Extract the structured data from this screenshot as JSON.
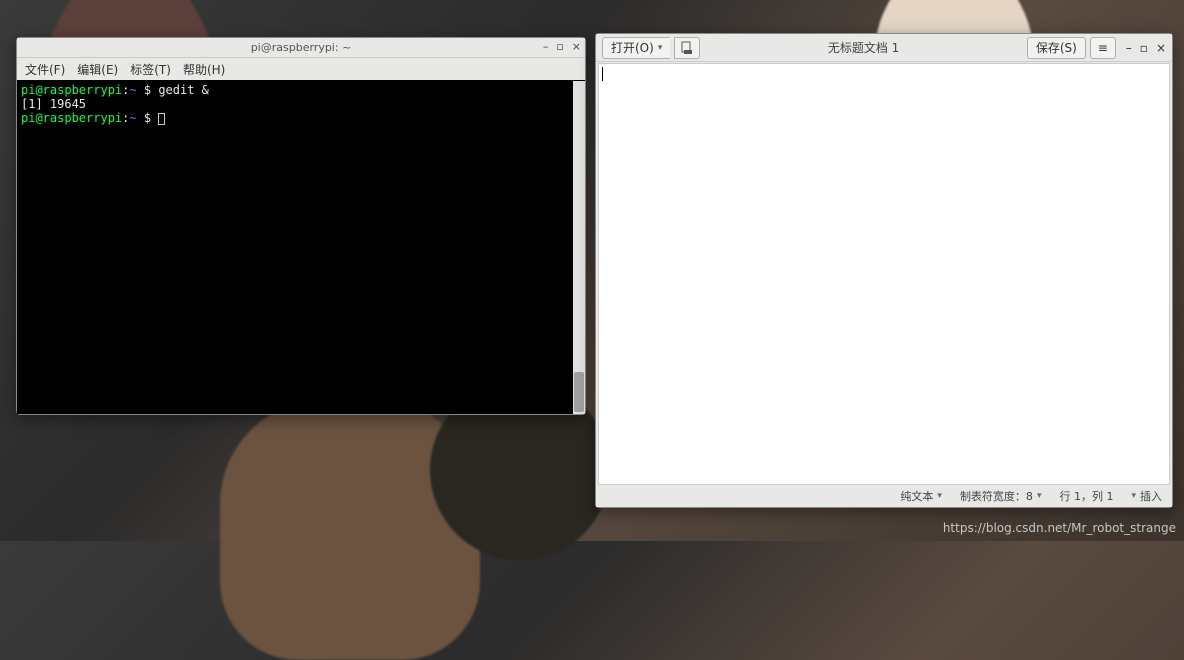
{
  "terminal": {
    "title": "pi@raspberrypi: ~",
    "menu": {
      "file": "文件(F)",
      "edit": "编辑(E)",
      "tabs": "标签(T)",
      "help": "帮助(H)"
    },
    "line1": {
      "userhost": "pi@raspberrypi",
      "sep": ":",
      "path": "~",
      "prompt": " $ ",
      "cmd": "gedit &"
    },
    "line2": "[1] 19645",
    "line3": {
      "userhost": "pi@raspberrypi",
      "sep": ":",
      "path": "~",
      "prompt": " $ "
    },
    "win": {
      "min": "–",
      "max": "▫",
      "close": "×"
    }
  },
  "gedit": {
    "open_label": "打开(O)",
    "title": "无标题文档 1",
    "save_label": "保存(S)",
    "status": {
      "filetype": "纯文本",
      "tabwidth_label": "制表符宽度：8",
      "pos": "行 1，列 1",
      "ins": "插入"
    },
    "win": {
      "min": "–",
      "max": "▫",
      "close": "×"
    }
  },
  "watermark": "https://blog.csdn.net/Mr_robot_strange"
}
